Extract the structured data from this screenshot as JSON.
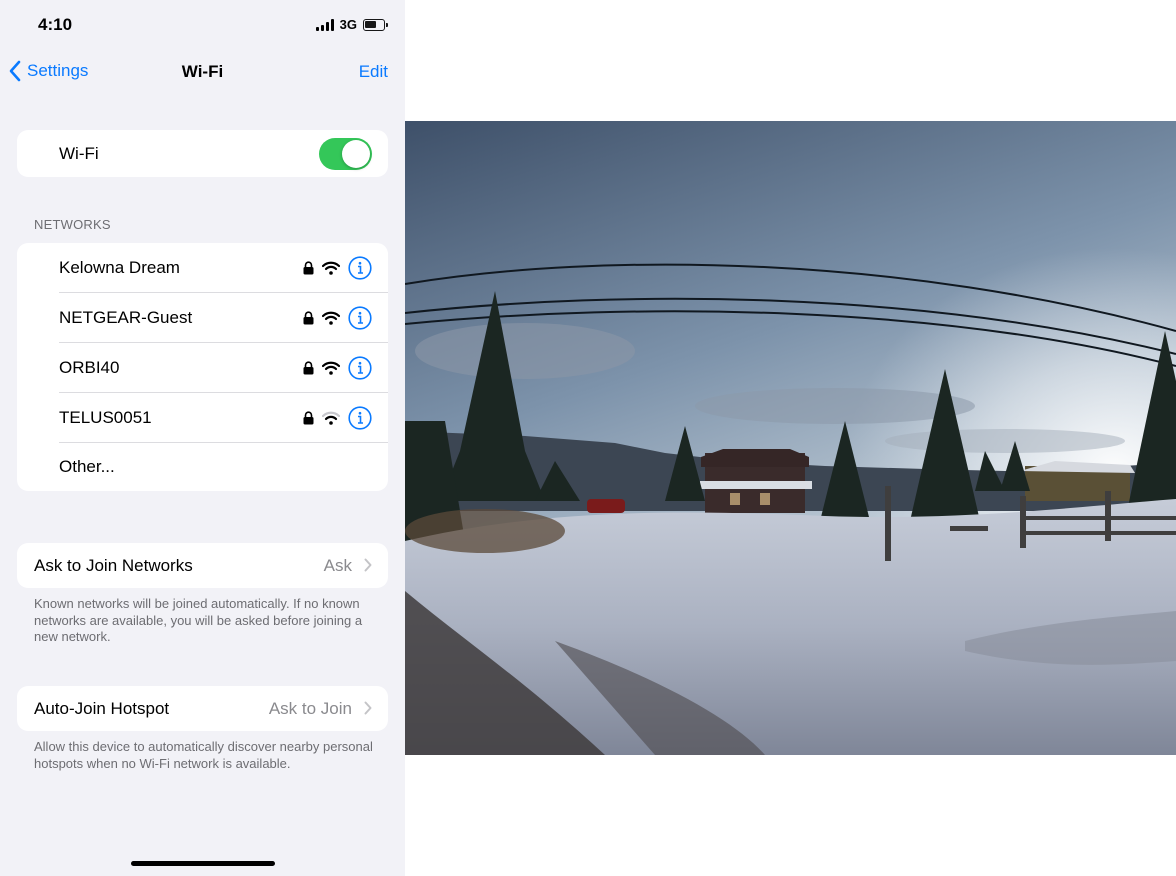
{
  "status_bar": {
    "time": "4:10",
    "network": "3G"
  },
  "nav": {
    "back_label": "Settings",
    "title": "Wi-Fi",
    "edit_label": "Edit"
  },
  "wifi_toggle": {
    "label": "Wi-Fi",
    "on": true
  },
  "networks": {
    "header": "NETWORKS",
    "items": [
      {
        "name": "Kelowna Dream",
        "secured": true,
        "signal": 3
      },
      {
        "name": "NETGEAR-Guest",
        "secured": true,
        "signal": 3
      },
      {
        "name": "ORBI40",
        "secured": true,
        "signal": 3
      },
      {
        "name": "TELUS0051",
        "secured": true,
        "signal": 2
      }
    ],
    "other_label": "Other..."
  },
  "ask_to_join": {
    "label": "Ask to Join Networks",
    "value": "Ask",
    "footnote": "Known networks will be joined automatically. If no known networks are available, you will be asked before joining a new network."
  },
  "auto_join_hotspot": {
    "label": "Auto-Join Hotspot",
    "value": "Ask to Join",
    "footnote": "Allow this device to automatically discover nearby personal hotspots when no Wi-Fi network is available."
  },
  "colors": {
    "accent": "#0a7aff",
    "toggle_on": "#34c759",
    "background": "#f2f2f7",
    "secondary_text": "#6d6d72"
  }
}
